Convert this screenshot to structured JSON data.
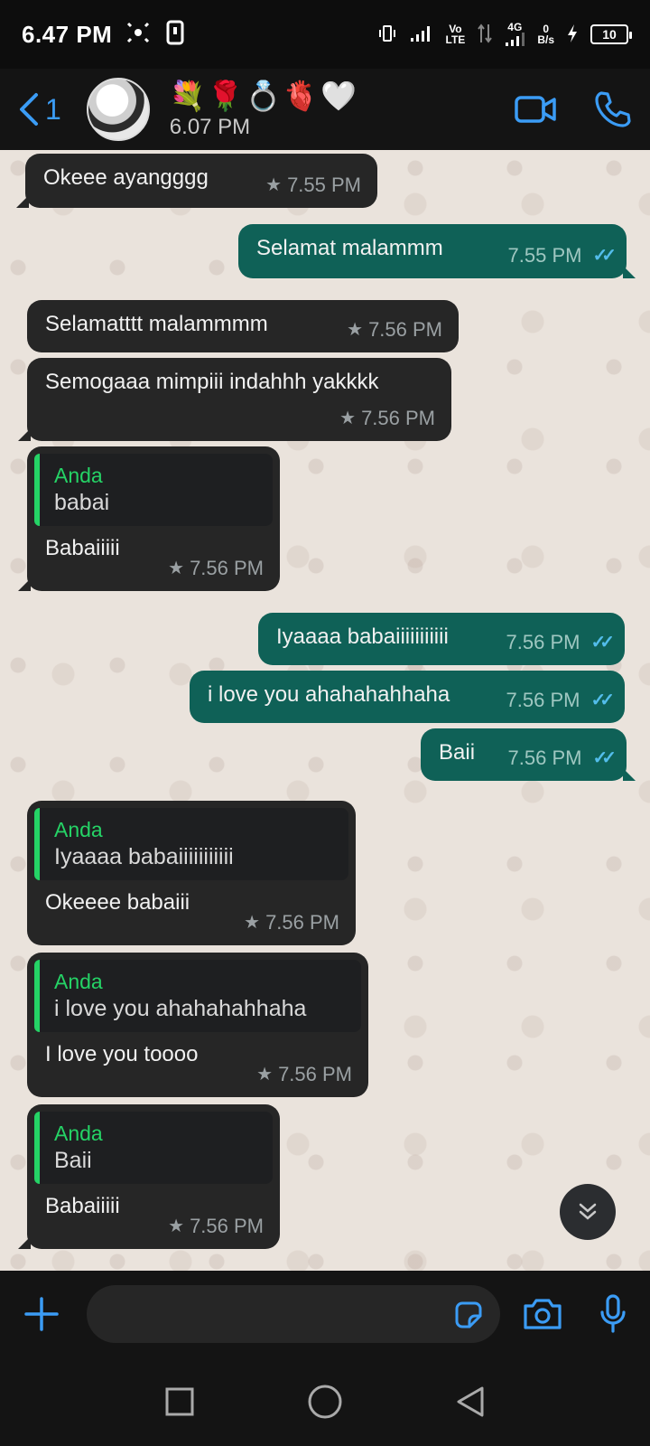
{
  "status_bar": {
    "time": "6.47 PM",
    "network_1": "Vo",
    "network_1b": "LTE",
    "network_2": "4G",
    "speed_value": "0",
    "speed_unit": "B/s",
    "battery": "10"
  },
  "header": {
    "back_count": "1",
    "contact_name": "💐🌹💍🫀🤍",
    "last_seen": "6.07 PM"
  },
  "messages": [
    {
      "text": "Okeee ayangggg",
      "time": "7.55 PM"
    },
    {
      "text": "Selamat malammm",
      "time": "7.55 PM"
    },
    {
      "text": "Selamatttt malammmm",
      "time": "7.56 PM"
    },
    {
      "text": "Semogaaa mimpiii indahhh yakkkk",
      "time": "7.56 PM"
    },
    {
      "quote_author": "Anda",
      "quote_text": "babai",
      "text": "Babaiiiii",
      "time": "7.56 PM"
    },
    {
      "text": "Iyaaaa babaiiiiiiiiiii",
      "time": "7.56 PM"
    },
    {
      "text": "i love you ahahahahhaha",
      "time": "7.56 PM"
    },
    {
      "text": "Baii",
      "time": "7.56 PM"
    },
    {
      "quote_author": "Anda",
      "quote_text": "Iyaaaa babaiiiiiiiiiii",
      "text": "Okeeee babaiii",
      "time": "7.56 PM"
    },
    {
      "quote_author": "Anda",
      "quote_text": "i love you ahahahahhaha",
      "text": "I love you toooo",
      "time": "7.56 PM"
    },
    {
      "quote_author": "Anda",
      "quote_text": "Baii",
      "text": "Babaiiiii",
      "time": "7.56 PM"
    }
  ],
  "input": {
    "placeholder": ""
  },
  "colors": {
    "accent": "#3b9cf5",
    "outgoing_bubble": "#0f6157",
    "incoming_bubble": "#262626",
    "quote_bar": "#25d366",
    "read_ticks": "#53bdeb"
  }
}
